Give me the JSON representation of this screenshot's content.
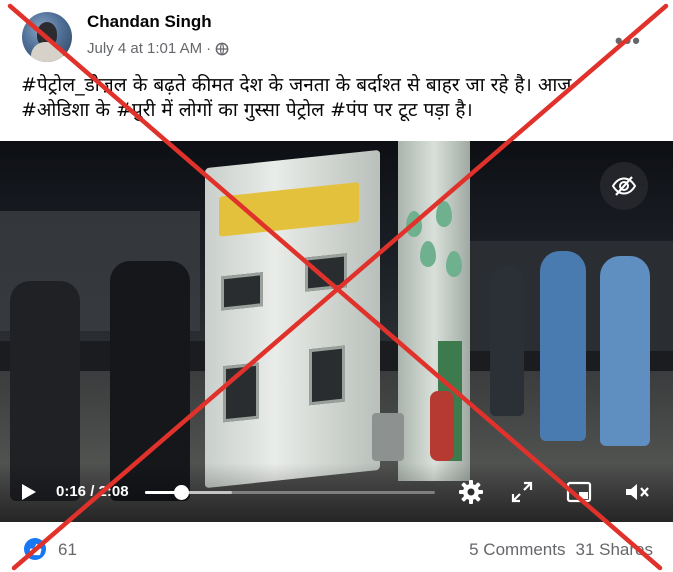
{
  "post": {
    "author": "Chandan Singh",
    "timestamp": "July 4 at 1:01 AM",
    "separator": "·",
    "privacy_icon": "globe-icon",
    "more_label": "•••",
    "text_line1": "#पेट्रोल_डीज़ल के बढ़ते कीमत देश के जनता के बर्दाश्त से बाहर जा रहे है। आज",
    "text_line2": "#ओडिशा के #पुरी में लोगों का गुस्सा पेट्रोल #पंप पर टूट पड़ा है।"
  },
  "video": {
    "current_time": "0:16",
    "duration": "2:08",
    "time_display": "0:16 / 2:08",
    "played_fraction": 0.125,
    "buffered_fraction": 0.3,
    "icons": [
      "play-icon",
      "settings-gear-icon",
      "fullscreen-icon",
      "picture-in-picture-icon",
      "mute-icon",
      "visibility-off-icon"
    ]
  },
  "footer": {
    "like_count": "61",
    "comments": "5 Comments",
    "shares": "31 Shares"
  },
  "colors": {
    "accent": "#1877f2",
    "muted_text": "#65676b",
    "cross_red": "#e0322b"
  }
}
